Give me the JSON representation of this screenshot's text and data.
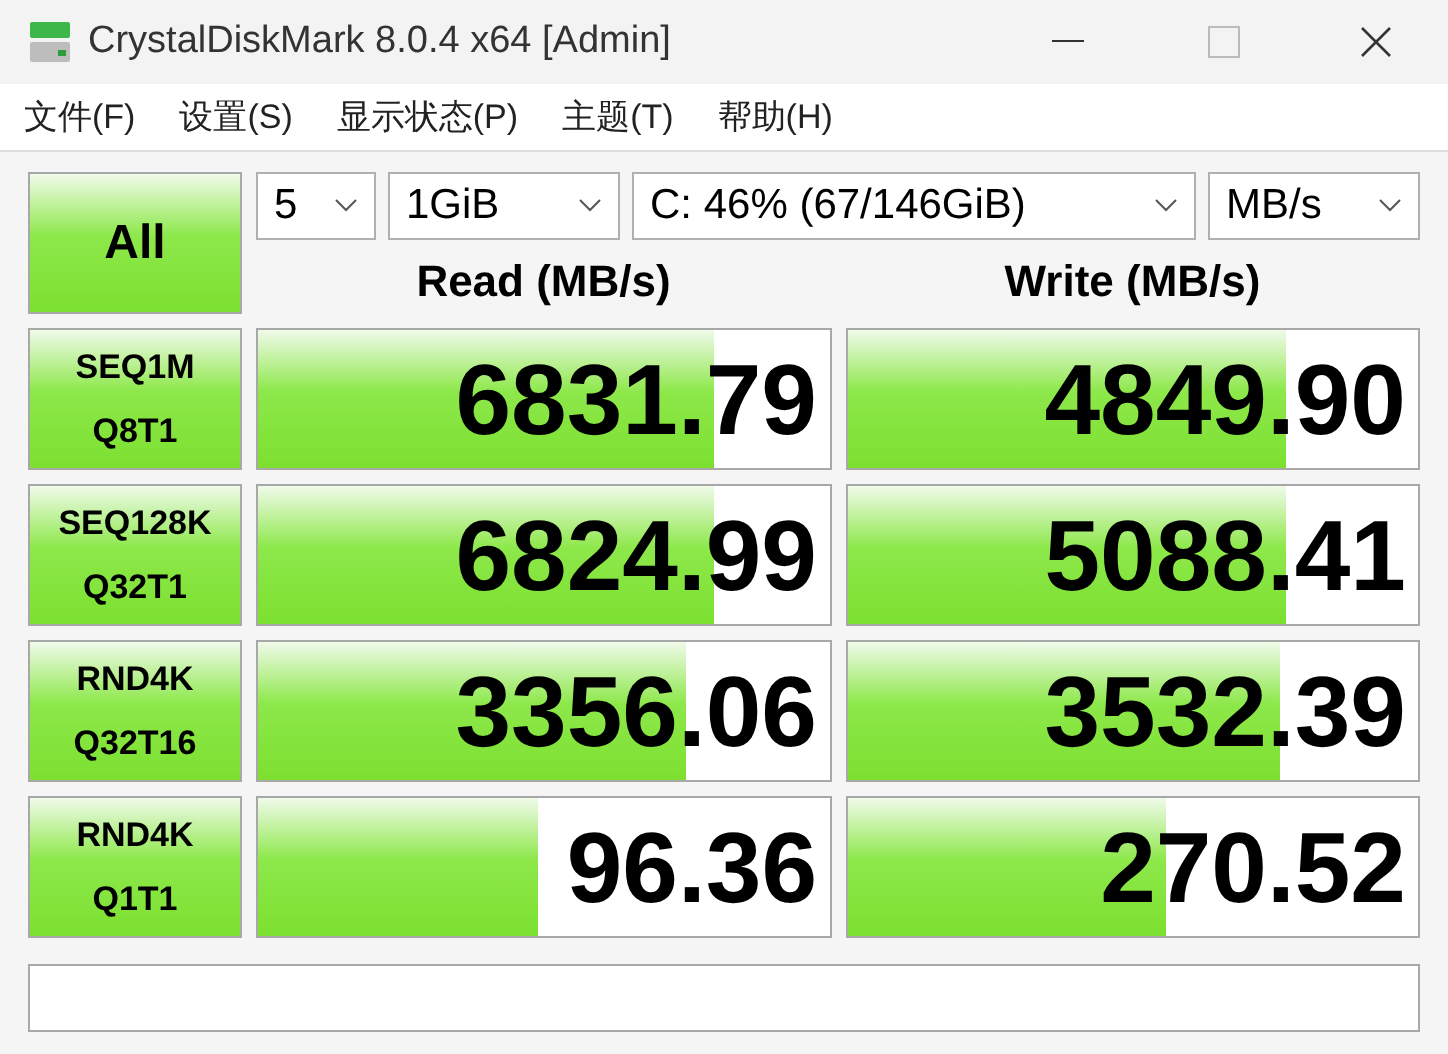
{
  "window": {
    "title": "CrystalDiskMark 8.0.4 x64 [Admin]"
  },
  "menu": [
    "文件(F)",
    "设置(S)",
    "显示状态(P)",
    "主题(T)",
    "帮助(H)"
  ],
  "all_button": "All",
  "selects": [
    {
      "value": "5"
    },
    {
      "value": "1GiB"
    },
    {
      "value": "C: 46% (67/146GiB)"
    },
    {
      "value": "MB/s"
    }
  ],
  "columns": [
    "Read (MB/s)",
    "Write (MB/s)"
  ],
  "rows": [
    {
      "test": [
        "SEQ1M",
        "Q8T1"
      ],
      "read": {
        "value": "6831.79",
        "level": 0.8
      },
      "write": {
        "value": "4849.90",
        "level": 0.77
      }
    },
    {
      "test": [
        "SEQ128K",
        "Q32T1"
      ],
      "read": {
        "value": "6824.99",
        "level": 0.8
      },
      "write": {
        "value": "5088.41",
        "level": 0.77
      }
    },
    {
      "test": [
        "RND4K",
        "Q32T16"
      ],
      "read": {
        "value": "3356.06",
        "level": 0.75
      },
      "write": {
        "value": "3532.39",
        "level": 0.76
      }
    },
    {
      "test": [
        "RND4K",
        "Q1T1"
      ],
      "read": {
        "value": "96.36",
        "level": 0.49
      },
      "write": {
        "value": "270.52",
        "level": 0.56
      }
    }
  ]
}
